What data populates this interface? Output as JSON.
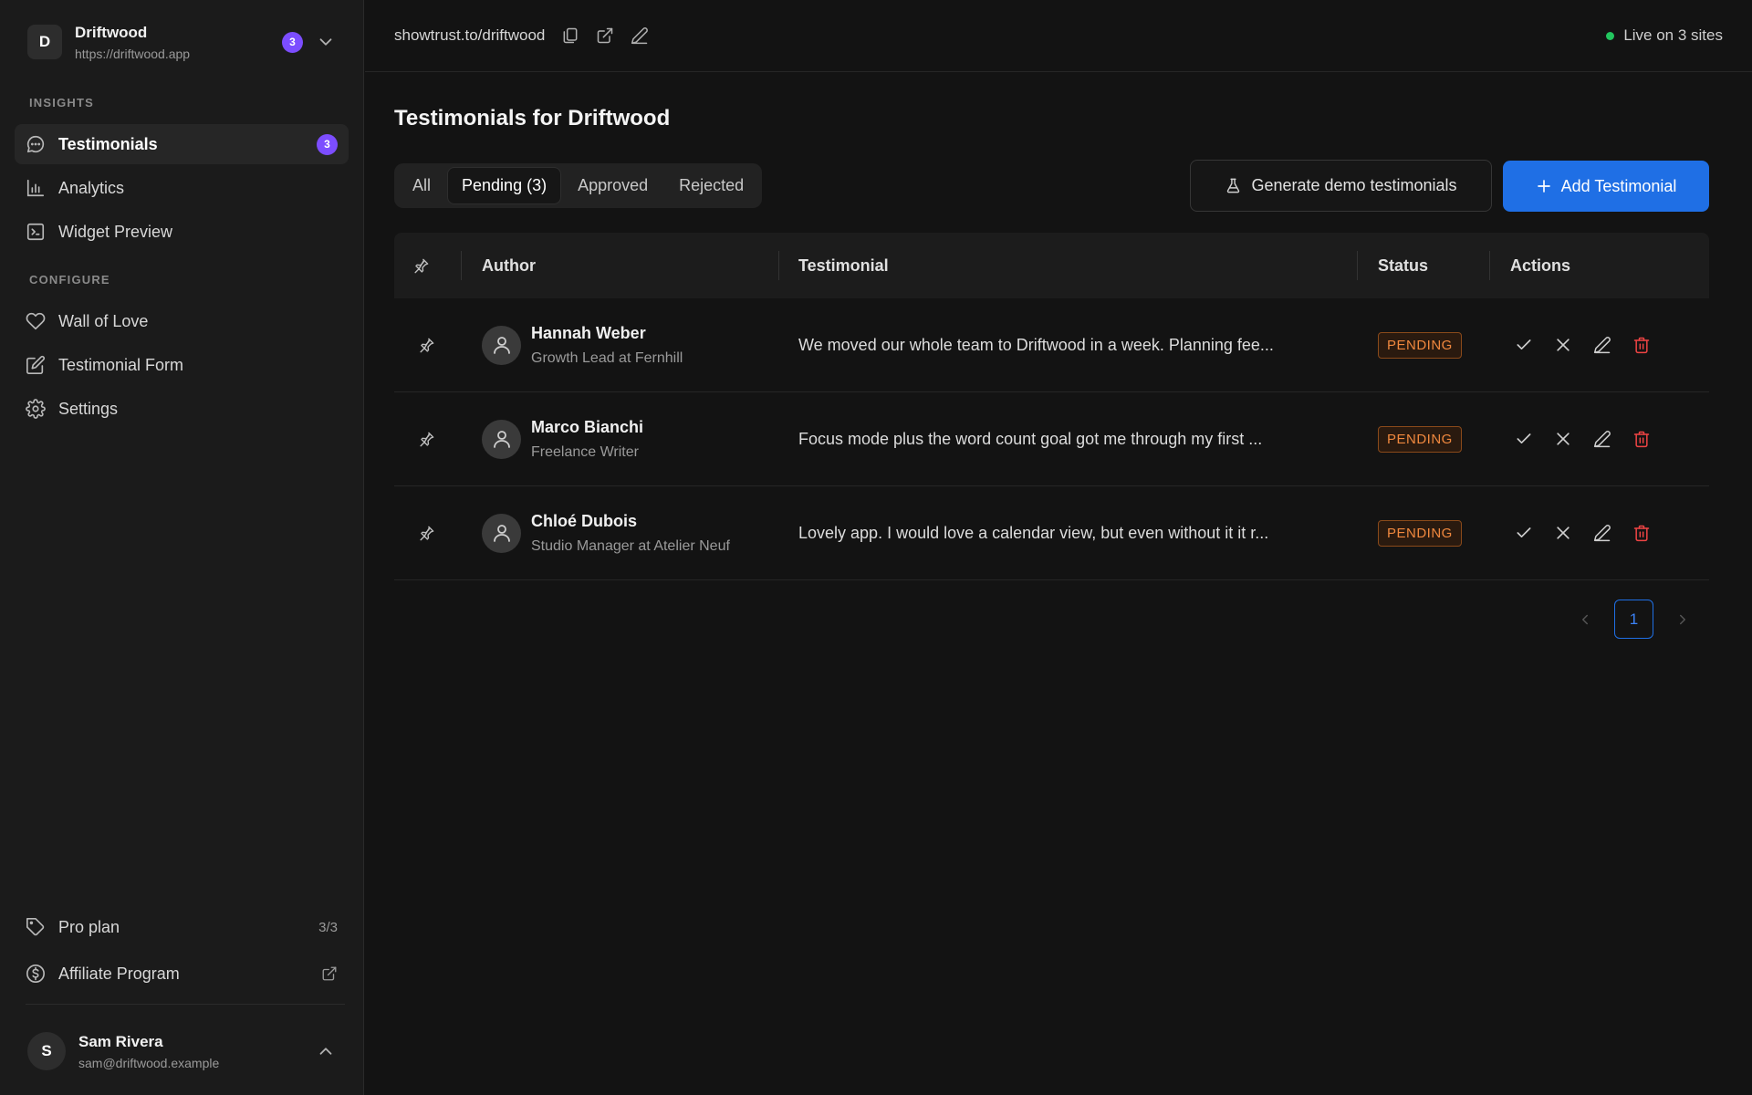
{
  "workspace": {
    "initial": "D",
    "name": "Driftwood",
    "url": "https://driftwood.app",
    "badge": "3"
  },
  "sidebar": {
    "insights_label": "INSIGHTS",
    "configure_label": "CONFIGURE",
    "insights": [
      {
        "label": "Testimonials",
        "icon": "chat-bubble-icon",
        "badge": "3"
      },
      {
        "label": "Analytics",
        "icon": "bar-chart-icon"
      },
      {
        "label": "Widget Preview",
        "icon": "terminal-icon"
      }
    ],
    "configure": [
      {
        "label": "Wall of Love",
        "icon": "heart-icon"
      },
      {
        "label": "Testimonial Form",
        "icon": "edit-form-icon"
      },
      {
        "label": "Settings",
        "icon": "gear-icon"
      }
    ],
    "plan": {
      "label": "Pro plan",
      "usage": "3/3"
    },
    "affiliate": {
      "label": "Affiliate Program"
    },
    "user": {
      "initial": "S",
      "name": "Sam Rivera",
      "email": "sam@driftwood.example"
    }
  },
  "topbar": {
    "url": "showtrust.to/driftwood",
    "live_text": "Live on 3 sites",
    "live_color": "#22c55e"
  },
  "main": {
    "title": "Testimonials for Driftwood",
    "tabs": [
      {
        "label": "All"
      },
      {
        "label": "Pending (3)",
        "active": true
      },
      {
        "label": "Approved"
      },
      {
        "label": "Rejected"
      }
    ],
    "demo_button": "Generate demo testimonials",
    "add_button": "Add Testimonial"
  },
  "table": {
    "headers": {
      "author": "Author",
      "testimonial": "Testimonial",
      "status": "Status",
      "actions": "Actions"
    },
    "rows": [
      {
        "name": "Hannah Weber",
        "role": "Growth Lead at Fernhill",
        "text": "We moved our whole team to Driftwood in a week. Planning fee...",
        "status": "PENDING"
      },
      {
        "name": "Marco Bianchi",
        "role": "Freelance Writer",
        "text": "Focus mode plus the word count goal got me through my first ...",
        "status": "PENDING"
      },
      {
        "name": "Chloé Dubois",
        "role": "Studio Manager at Atelier Neuf",
        "text": "Lovely app. I would love a calendar view, but even without it it r...",
        "status": "PENDING"
      }
    ]
  },
  "pagination": {
    "current": "1"
  },
  "colors": {
    "accent": "#1f6fe5",
    "badge_purple": "#7c4dff",
    "pending": "#f0883e",
    "danger": "#ef4444"
  }
}
